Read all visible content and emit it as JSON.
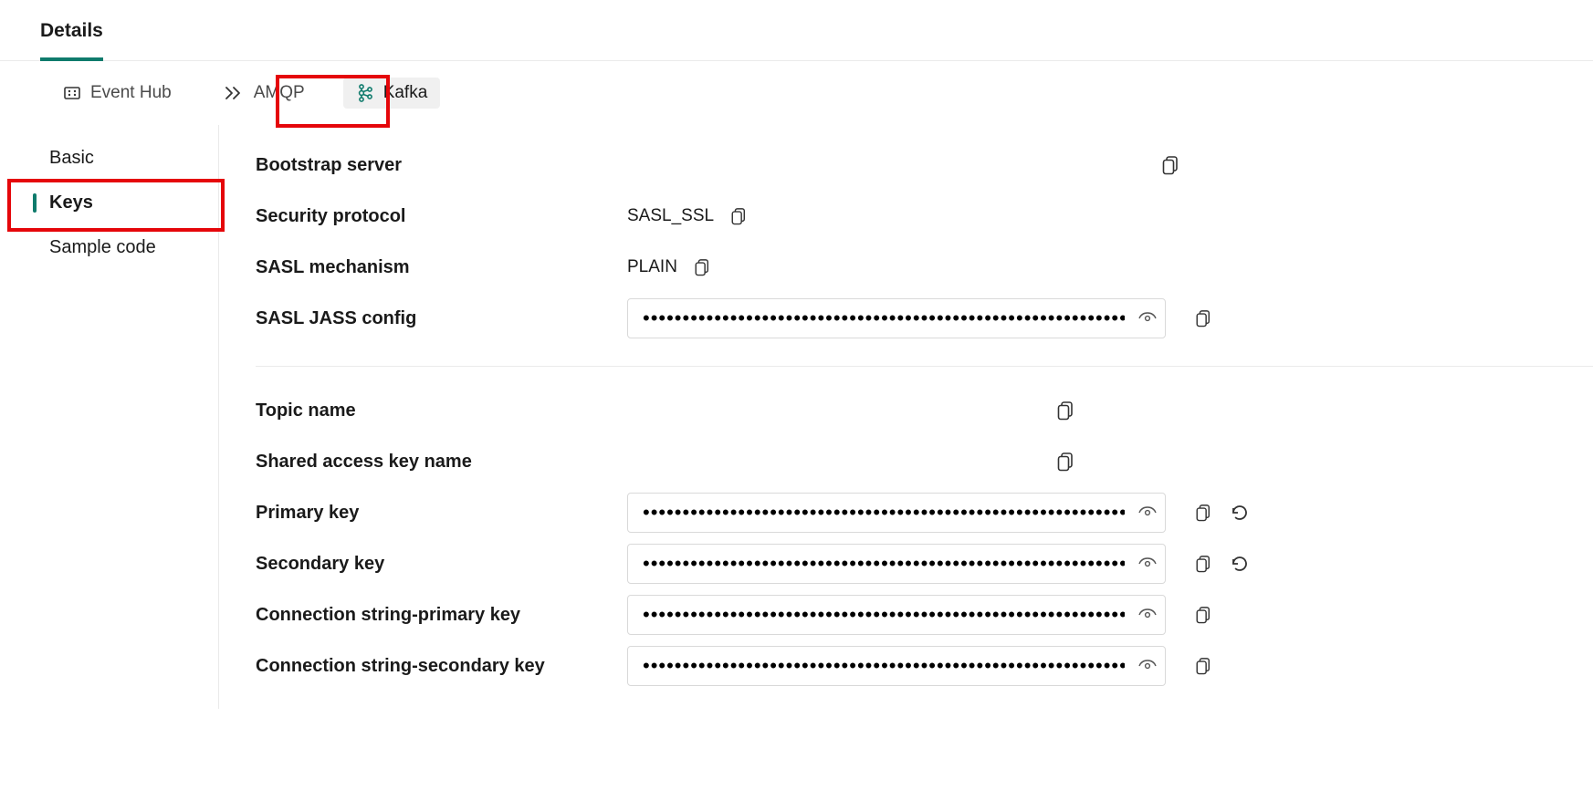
{
  "header_tab": "Details",
  "protocol_tabs": [
    {
      "label": "Event Hub"
    },
    {
      "label": "AMQP"
    },
    {
      "label": "Kafka"
    }
  ],
  "sidebar": {
    "items": [
      {
        "label": "Basic"
      },
      {
        "label": "Keys"
      },
      {
        "label": "Sample code"
      }
    ]
  },
  "fields": {
    "bootstrap_server": {
      "label": "Bootstrap server",
      "value": ""
    },
    "security_protocol": {
      "label": "Security protocol",
      "value": "SASL_SSL"
    },
    "sasl_mechanism": {
      "label": "SASL mechanism",
      "value": "PLAIN"
    },
    "sasl_jass_config": {
      "label": "SASL JASS config"
    },
    "topic_name": {
      "label": "Topic name",
      "value": ""
    },
    "shared_access_key_name": {
      "label": "Shared access key name",
      "value": ""
    },
    "primary_key": {
      "label": "Primary key"
    },
    "secondary_key": {
      "label": "Secondary key"
    },
    "conn_primary": {
      "label": "Connection string-primary key"
    },
    "conn_secondary": {
      "label": "Connection string-secondary key"
    }
  },
  "secret_mask": "••••••••••••••••••••••••••••••••••••••••••••••••••••••••••••••••••••••••"
}
